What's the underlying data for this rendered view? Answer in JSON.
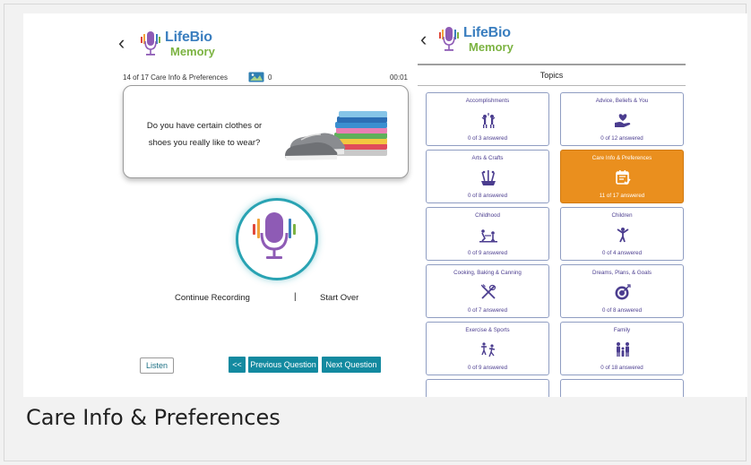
{
  "caption": "Care Info & Preferences",
  "left_pane": {
    "back_glyph": "‹",
    "logo": {
      "life": "LifeBio",
      "memory": "Memory"
    },
    "progress_text": "14 of 17 Care Info & Preferences",
    "photo_count": "0",
    "timer": "00:01",
    "question_line1": "Do you have certain clothes or",
    "question_line2": "shoes you really like to wear?",
    "continue_label": "Continue Recording",
    "divider": "|",
    "start_over_label": "Start Over",
    "listen_label": "Listen",
    "first_label": "<<",
    "prev_label": "Previous Question",
    "next_label": "Next Question"
  },
  "right_pane": {
    "back_glyph": "‹",
    "logo": {
      "life": "LifeBio",
      "memory": "Memory"
    },
    "header": "Topics",
    "topics": [
      {
        "title": "Accomplishments",
        "count": "0 of 3 answered",
        "icon": "people-celebrating-icon"
      },
      {
        "title": "Advice, Beliefs & You",
        "count": "0 of 12 answered",
        "icon": "heart-in-hand-icon"
      },
      {
        "title": "Arts & Crafts",
        "count": "0 of 8 answered",
        "icon": "paint-brushes-icon"
      },
      {
        "title": "Care Info & Preferences",
        "count": "11 of 17 answered",
        "icon": "calendar-check-icon",
        "selected": true
      },
      {
        "title": "Childhood",
        "count": "0 of 9 answered",
        "icon": "children-playing-icon"
      },
      {
        "title": "Children",
        "count": "0 of 4 answered",
        "icon": "child-jumping-icon"
      },
      {
        "title": "Cooking, Baking & Canning",
        "count": "0 of 7 answered",
        "icon": "utensils-crossed-icon"
      },
      {
        "title": "Dreams, Plans, & Goals",
        "count": "0 of 8 answered",
        "icon": "target-icon"
      },
      {
        "title": "Exercise & Sports",
        "count": "0 of 9 answered",
        "icon": "sports-figures-icon"
      },
      {
        "title": "Family",
        "count": "0 of 18 answered",
        "icon": "family-icon"
      }
    ]
  },
  "colors": {
    "accent_teal": "#138aa0",
    "selected_tile": "#ea8f1e",
    "tile_text": "#4b3d8f",
    "logo_blue": "#3a7ebf",
    "logo_green": "#7cb342",
    "mic_purple": "#8e5bb5"
  }
}
